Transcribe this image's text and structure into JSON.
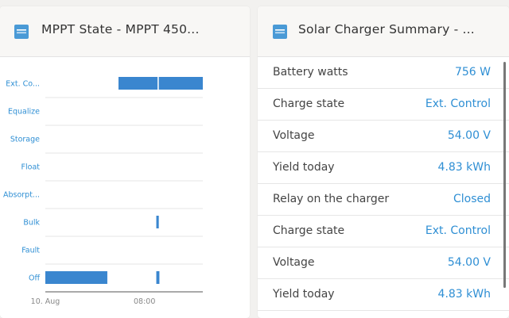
{
  "left_panel": {
    "title": "MPPT State - MPPT 450...",
    "icon": "device-icon"
  },
  "right_panel": {
    "title": "Solar Charger Summary - ...",
    "icon": "device-icon",
    "rows": [
      {
        "label": "Battery watts",
        "value": "756 W"
      },
      {
        "label": "Charge state",
        "value": "Ext. Control"
      },
      {
        "label": "Voltage",
        "value": "54.00 V"
      },
      {
        "label": "Yield today",
        "value": "4.83 kWh"
      },
      {
        "label": "Relay on the charger",
        "value": "Closed"
      },
      {
        "label": "Charge state",
        "value": "Ext. Control"
      },
      {
        "label": "Voltage",
        "value": "54.00 V"
      },
      {
        "label": "Yield today",
        "value": "4.83 kWh"
      }
    ]
  },
  "colors": {
    "accent": "#2f8fd4",
    "bar": "#3a86cf"
  },
  "chart_data": {
    "type": "bar",
    "categories": [
      "Ext. Co...",
      "Equalize",
      "Storage",
      "Float",
      "Absorpt...",
      "Bulk",
      "Fault",
      "Off"
    ],
    "x_ticks": [
      "10. Aug",
      "08:00"
    ],
    "x_tick_hours": [
      0,
      8
    ],
    "x_range_hours": [
      0,
      12.7
    ],
    "segments": [
      {
        "state": "Ext. Co...",
        "start": 5.9,
        "end": 9.05
      },
      {
        "state": "Ext. Co...",
        "start": 9.15,
        "end": 12.7
      },
      {
        "state": "Bulk",
        "start": 8.95,
        "end": 9.15
      },
      {
        "state": "Off",
        "start": 0,
        "end": 5.0
      },
      {
        "state": "Off",
        "start": 8.95,
        "end": 9.2
      }
    ]
  }
}
